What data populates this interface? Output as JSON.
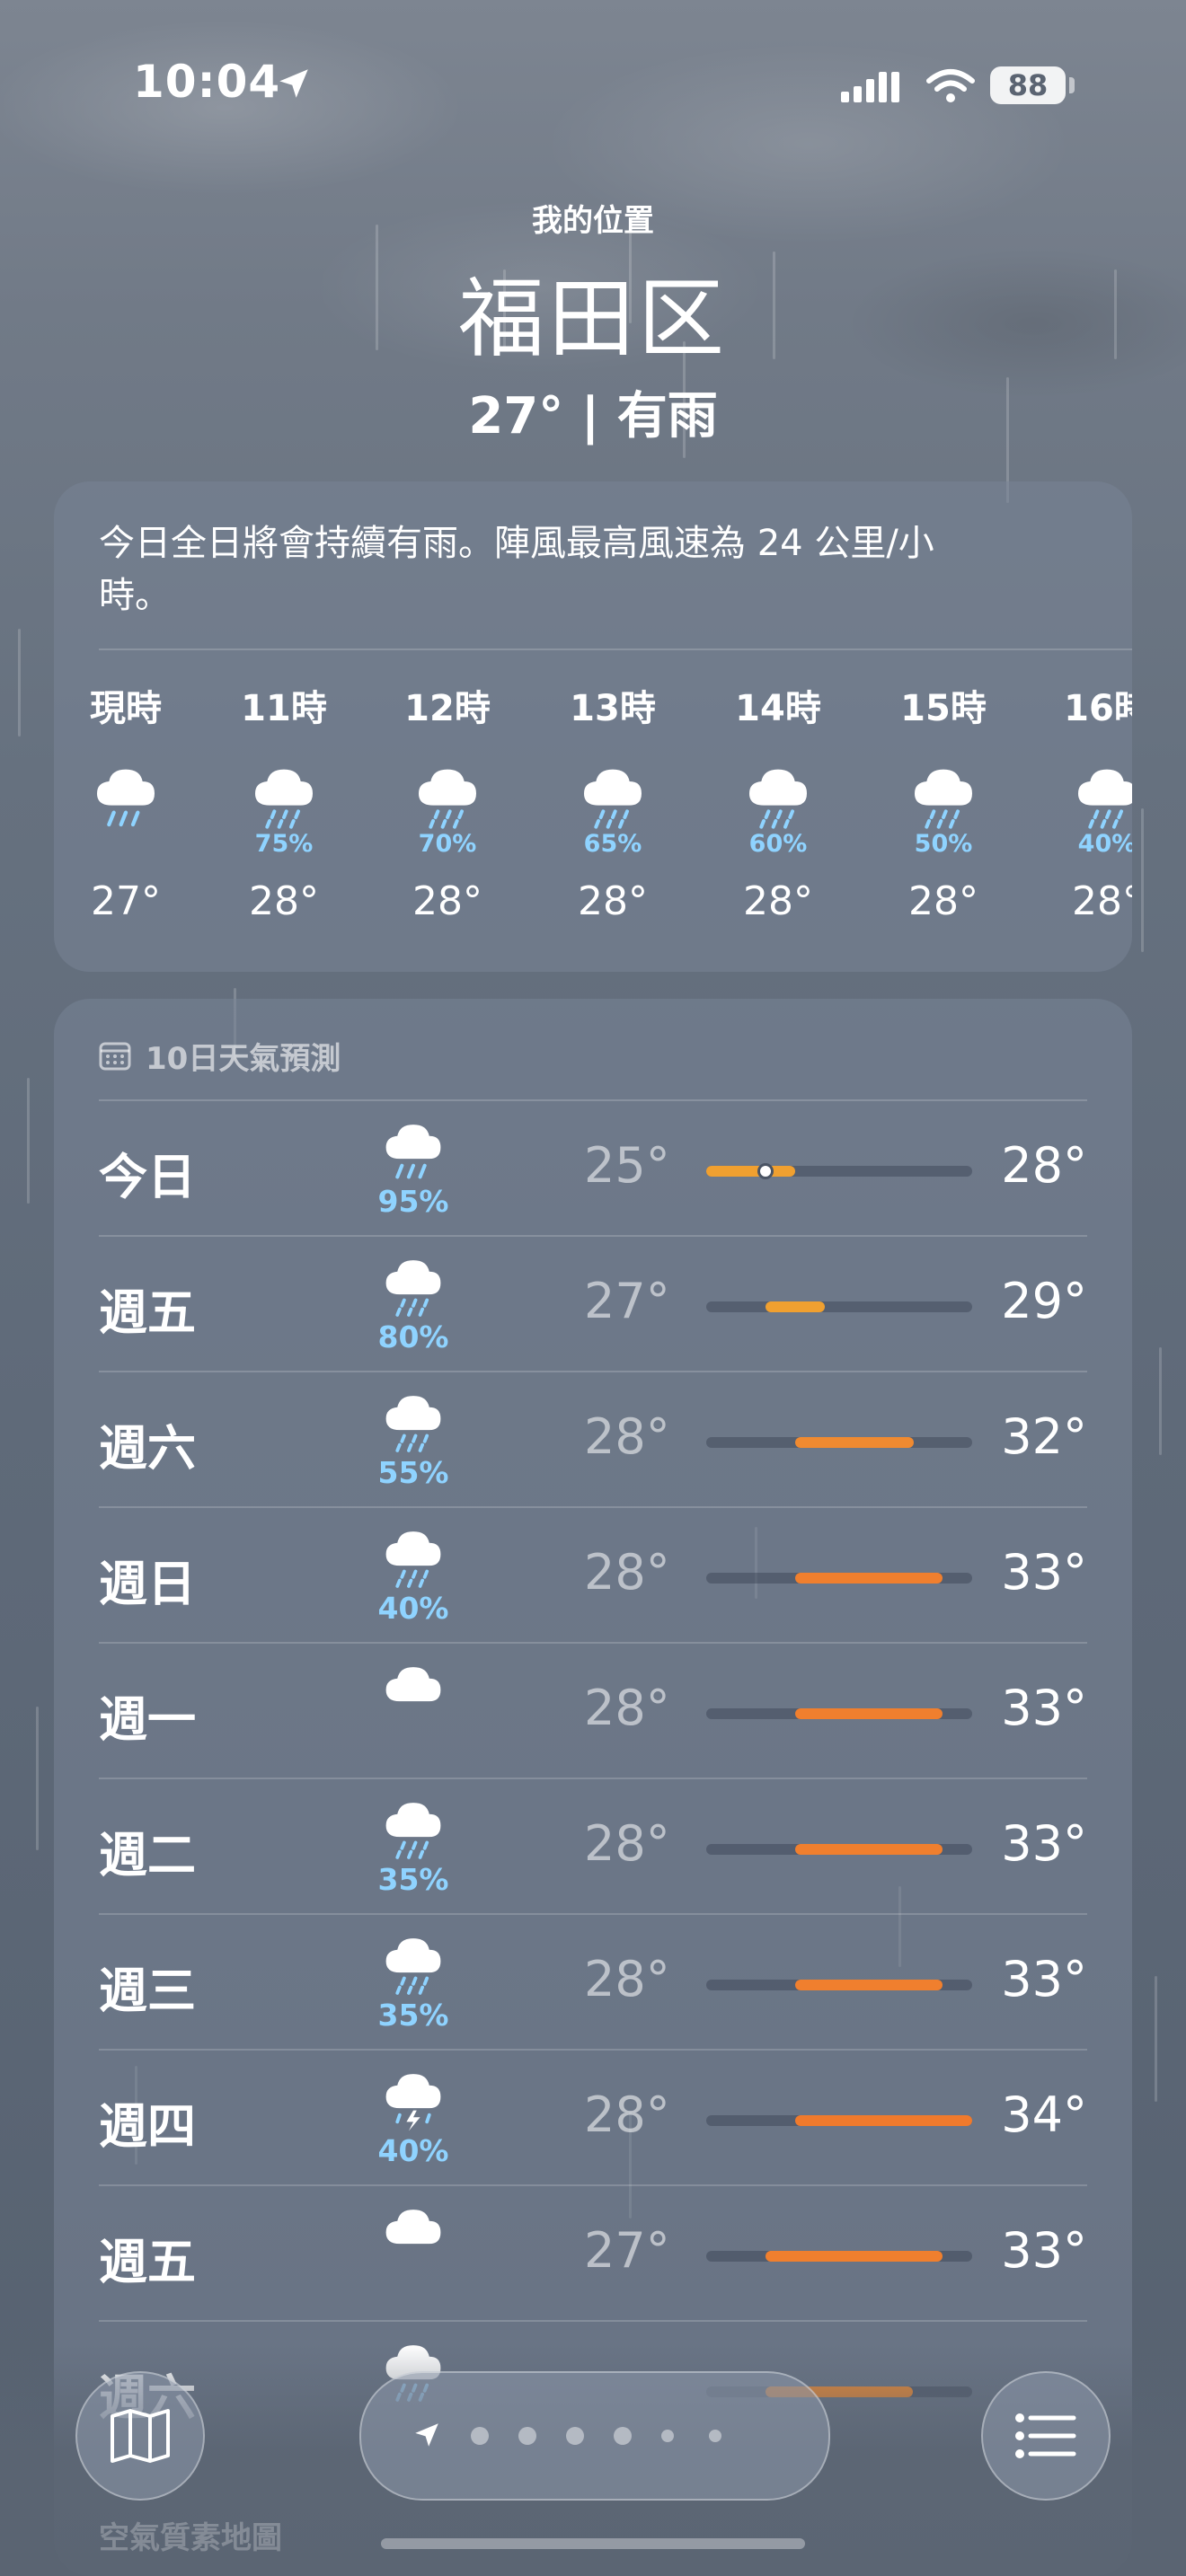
{
  "status_bar": {
    "time": "10:04",
    "battery": "88"
  },
  "location": {
    "my_location_label": "我的位置",
    "city": "福田区",
    "current": "27° | 有雨"
  },
  "hourly": {
    "description": "今日全日將會持續有雨。陣風最高風速為 24 公里/小時。",
    "items": [
      {
        "label": "現時",
        "icon": "rain-icon",
        "pct": "",
        "temp": "27°"
      },
      {
        "label": "11時",
        "icon": "drizzle-icon",
        "pct": "75%",
        "temp": "28°"
      },
      {
        "label": "12時",
        "icon": "drizzle-icon",
        "pct": "70%",
        "temp": "28°"
      },
      {
        "label": "13時",
        "icon": "drizzle-icon",
        "pct": "65%",
        "temp": "28°"
      },
      {
        "label": "14時",
        "icon": "drizzle-icon",
        "pct": "60%",
        "temp": "28°"
      },
      {
        "label": "15時",
        "icon": "drizzle-icon",
        "pct": "50%",
        "temp": "28°"
      },
      {
        "label": "16時",
        "icon": "drizzle-icon",
        "pct": "40%",
        "temp": "28°"
      }
    ]
  },
  "daily": {
    "header": "10日天氣預測",
    "range_min": 25,
    "range_max": 34,
    "rows": [
      {
        "day": "今日",
        "icon": "rain-icon",
        "pct": "95%",
        "low": "25°",
        "high": "28°",
        "low_v": 25,
        "high_v": 28,
        "current_v": 27,
        "color": "#f0a030"
      },
      {
        "day": "週五",
        "icon": "drizzle-icon",
        "pct": "80%",
        "low": "27°",
        "high": "29°",
        "low_v": 27,
        "high_v": 29,
        "color": "#f0a030"
      },
      {
        "day": "週六",
        "icon": "drizzle-icon",
        "pct": "55%",
        "low": "28°",
        "high": "32°",
        "low_v": 28,
        "high_v": 32,
        "color": "#f08a30"
      },
      {
        "day": "週日",
        "icon": "drizzle-icon",
        "pct": "40%",
        "low": "28°",
        "high": "33°",
        "low_v": 28,
        "high_v": 33,
        "color": "#f07f2e"
      },
      {
        "day": "週一",
        "icon": "cloud-icon",
        "pct": "",
        "low": "28°",
        "high": "33°",
        "low_v": 28,
        "high_v": 33,
        "color": "#f07f2e"
      },
      {
        "day": "週二",
        "icon": "drizzle-icon",
        "pct": "35%",
        "low": "28°",
        "high": "33°",
        "low_v": 28,
        "high_v": 33,
        "color": "#f07f2e"
      },
      {
        "day": "週三",
        "icon": "drizzle-icon",
        "pct": "35%",
        "low": "28°",
        "high": "33°",
        "low_v": 28,
        "high_v": 33,
        "color": "#f07f2e"
      },
      {
        "day": "週四",
        "icon": "thunderstorm-icon",
        "pct": "40%",
        "low": "28°",
        "high": "34°",
        "low_v": 28,
        "high_v": 34,
        "color": "#f07a2c"
      },
      {
        "day": "週五",
        "icon": "cloud-icon",
        "pct": "",
        "low": "27°",
        "high": "33°",
        "low_v": 27,
        "high_v": 33,
        "color": "#f07f2e"
      },
      {
        "day": "週六",
        "icon": "drizzle-icon",
        "pct": "",
        "low": "",
        "high": "",
        "low_v": 27,
        "high_v": 32,
        "color": "#f08a30"
      }
    ]
  },
  "bottom": {
    "faded_label": "空氣質素地圖",
    "page_count": 7
  }
}
